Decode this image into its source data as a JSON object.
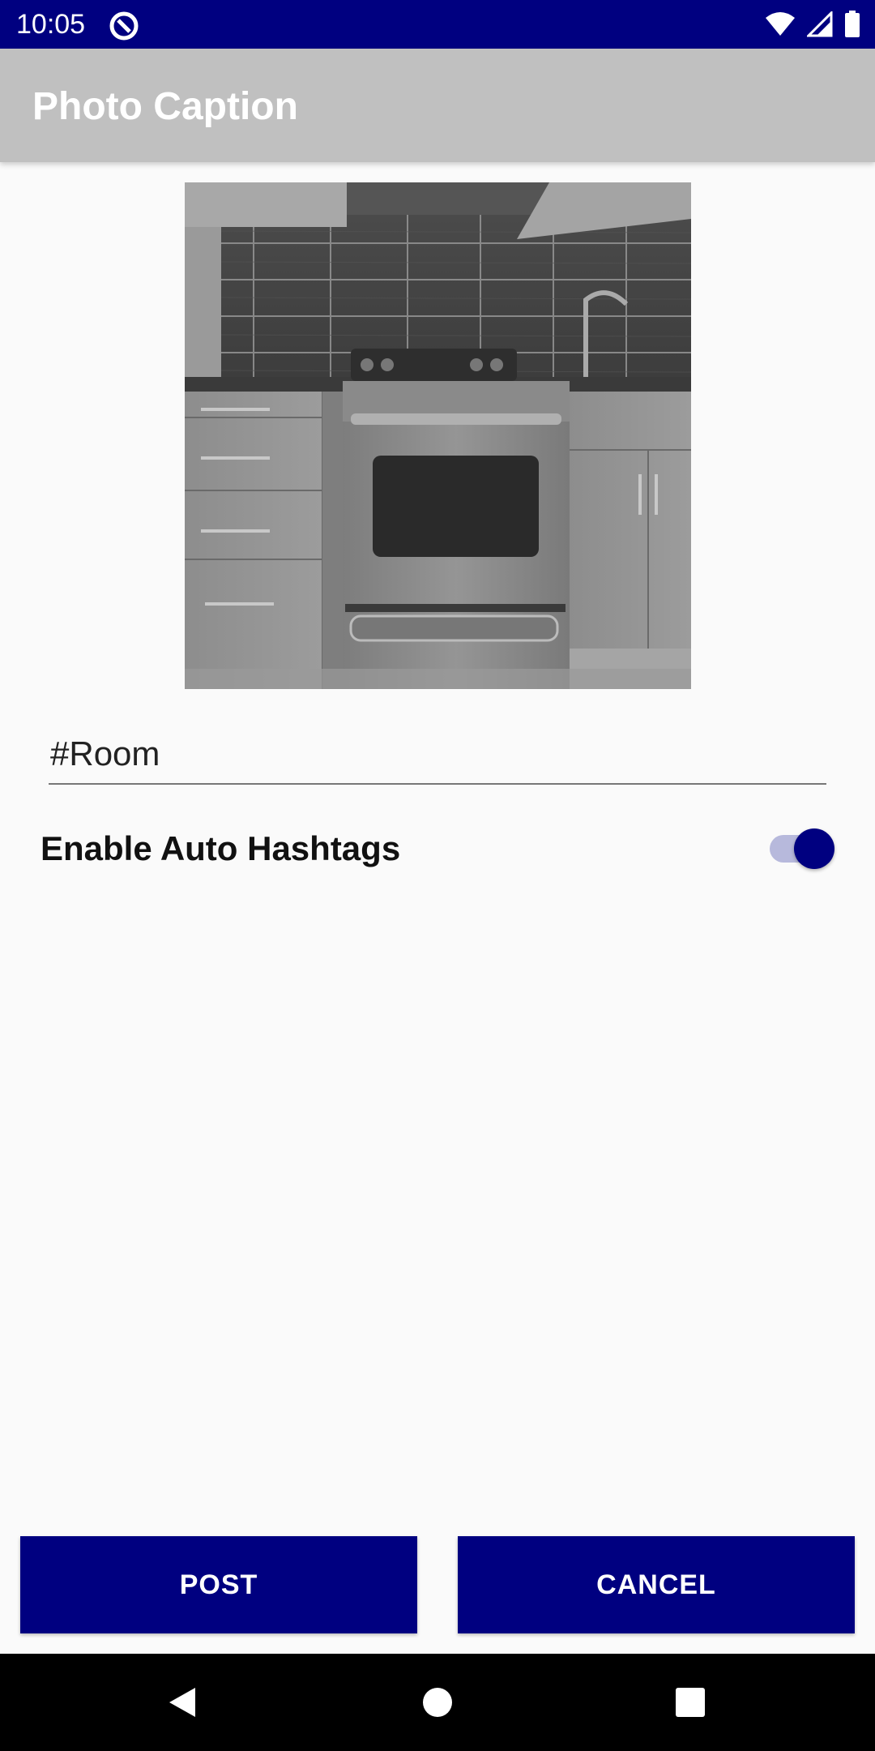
{
  "status_bar": {
    "time": "10:05",
    "icons": [
      "app-notification-icon",
      "wifi-icon",
      "signal-icon",
      "battery-icon"
    ]
  },
  "app_bar": {
    "title": "Photo Caption"
  },
  "photo": {
    "description_icon": "photo-kitchen-stove"
  },
  "caption": {
    "value": "#Room"
  },
  "auto_hashtags": {
    "label": "Enable Auto Hashtags",
    "enabled": true
  },
  "buttons": {
    "post": "POST",
    "cancel": "CANCEL"
  },
  "colors": {
    "primary": "#000080",
    "app_bar": "#c0c0c0",
    "switch_track": "#b7b9dc"
  },
  "nav_bar": {
    "icons": [
      "back-icon",
      "home-icon",
      "recents-icon"
    ]
  }
}
